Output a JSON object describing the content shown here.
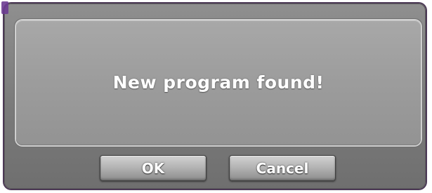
{
  "dialog": {
    "message": "New program found!",
    "buttons": {
      "ok_label": "OK",
      "cancel_label": "Cancel"
    },
    "colors": {
      "frame": "#7b7b7b",
      "panel": "#9c9c9c",
      "text": "#ffffff",
      "button_border": "#3f3f3f"
    }
  }
}
